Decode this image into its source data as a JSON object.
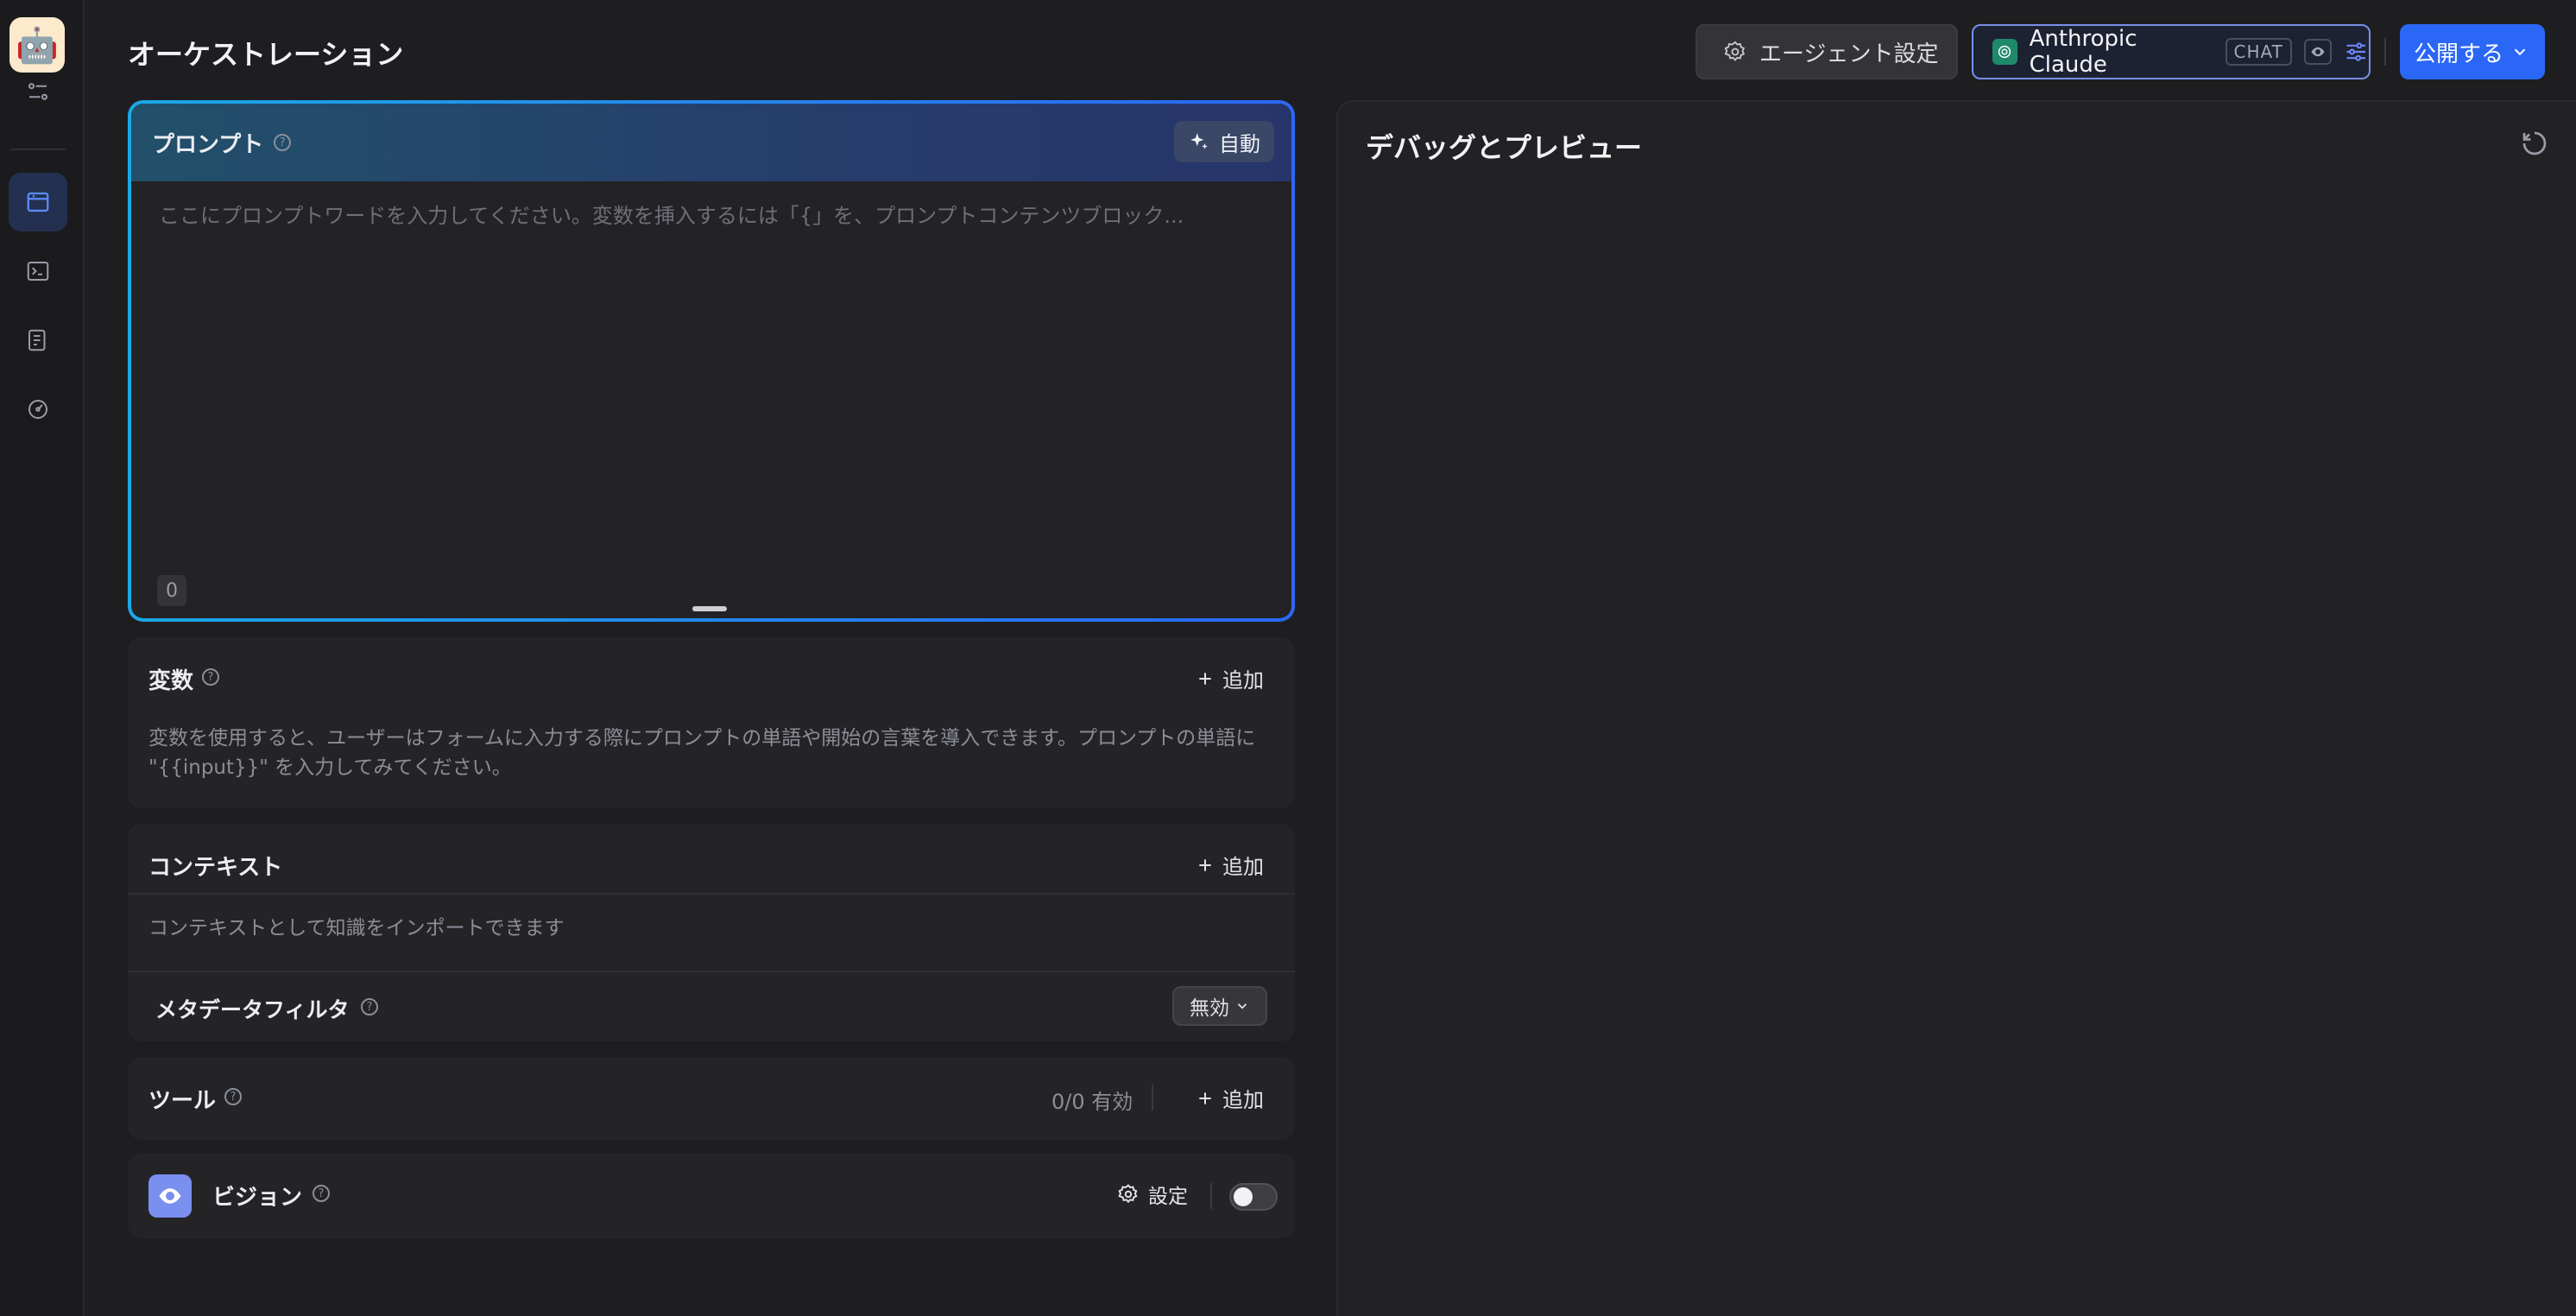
{
  "header": {
    "title": "オーケストレーション",
    "agent_settings_label": "エージェント設定",
    "model": {
      "name": "Anthropic Claude",
      "mode_tag": "CHAT"
    },
    "publish_label": "公開する"
  },
  "prompt": {
    "label": "プロンプト",
    "auto_label": "自動",
    "placeholder": "ここにプロンプトワードを入力してください。変数を挿入するには「{」を、プロンプトコンテンツブロック...",
    "char_count": "0"
  },
  "variables": {
    "title": "変数",
    "add_label": "追加",
    "description": "変数を使用すると、ユーザーはフォームに入力する際にプロンプトの単語や開始の言葉を導入できます。プロンプトの単語に \"{{input}}\" を入力してみてください。"
  },
  "context": {
    "title": "コンテキスト",
    "add_label": "追加",
    "description": "コンテキストとして知識をインポートできます",
    "metadata_filter_label": "メタデータフィルタ",
    "metadata_filter_value": "無効"
  },
  "tools": {
    "title": "ツール",
    "count": "0/0 有効",
    "add_label": "追加"
  },
  "vision": {
    "title": "ビジョン",
    "settings_label": "設定",
    "enabled": false
  },
  "debug": {
    "title": "デバッグとプレビュー"
  },
  "colors": {
    "accent": "#2b67f6",
    "prompt_border_start": "#1aa8e6",
    "vision_icon": "#7b8ff0"
  }
}
